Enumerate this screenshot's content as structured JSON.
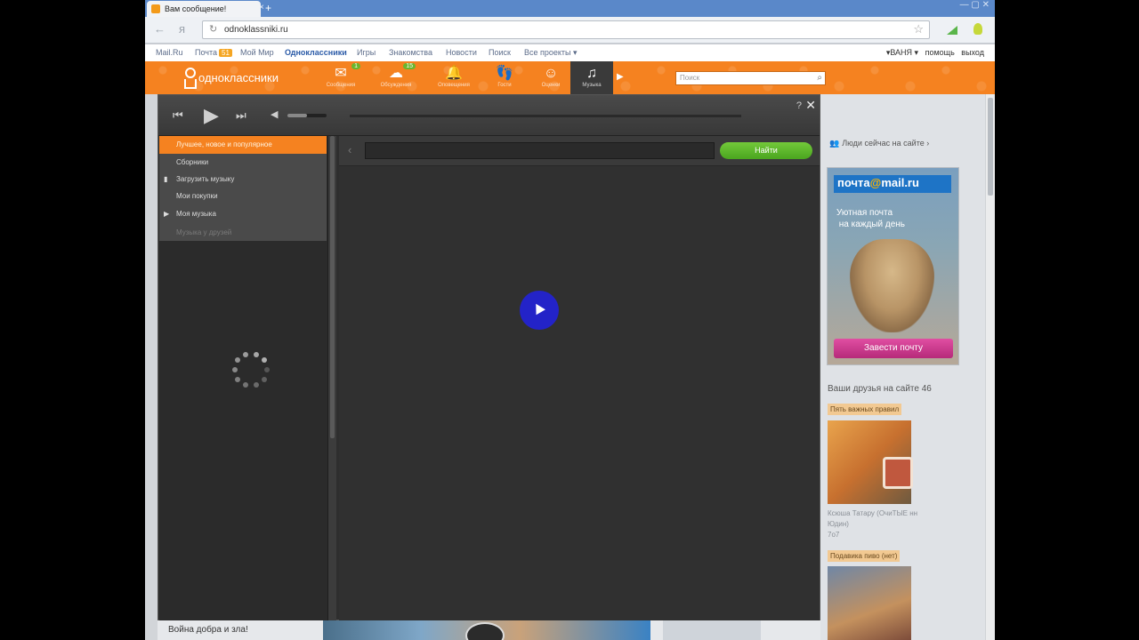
{
  "browser": {
    "tab_title": "Вам сообщение!",
    "tab_close": "×",
    "new_tab": "+",
    "win_controls": "— ▢ ✕",
    "url": "odnoklassniki.ru"
  },
  "mailbar": {
    "links": [
      "Mail.Ru",
      "Почта",
      "Мой Мир",
      "Одноклассники",
      "Игры",
      "Знакомства",
      "Новости",
      "Поиск",
      "Все проекты ▾"
    ],
    "mail_count": "51",
    "user": "▾ВАНЯ ▾",
    "help": "помощь",
    "exit": "выход"
  },
  "okbar": {
    "logo_text": "одноклассники",
    "icons": [
      {
        "name": "messages",
        "label": "Сообщения",
        "glyph": "✉",
        "badge": "1"
      },
      {
        "name": "discussions",
        "label": "Обсуждения",
        "glyph": "☁",
        "badge": "15"
      },
      {
        "name": "notifications",
        "label": "Оповещения",
        "glyph": "🔔",
        "badge": ""
      },
      {
        "name": "guests",
        "label": "Гости",
        "glyph": "👣",
        "badge": ""
      },
      {
        "name": "ratings",
        "label": "Оценки",
        "glyph": "☺",
        "badge": ""
      },
      {
        "name": "music",
        "label": "Музыка",
        "glyph": "♫",
        "badge": ""
      }
    ],
    "more": "▶",
    "search_placeholder": "Поиск"
  },
  "player": {
    "help": "?",
    "close": "✕",
    "volume_level": 0.5,
    "menu": [
      {
        "label": "Лучшее, новое и популярное",
        "state": "active",
        "icon": ""
      },
      {
        "label": "Сборники",
        "state": "normal",
        "icon": ""
      },
      {
        "label": "Загрузить музыку",
        "state": "normal",
        "icon": "▮"
      },
      {
        "label": "Мои покупки",
        "state": "normal",
        "icon": ""
      },
      {
        "label": "Моя музыка",
        "state": "normal",
        "icon": "▶"
      },
      {
        "label": "Музыка у друзей",
        "state": "disabled",
        "icon": ""
      }
    ],
    "search_value": "",
    "find_label": "Найти"
  },
  "right_col": {
    "people_online": "Люди сейчас на сайте ›",
    "ad": {
      "logo_prefix": "почта",
      "logo_at": "@",
      "logo_suffix": "mail.ru",
      "tagline": "Уютная почта\n на каждый день",
      "button": "Завести почту"
    },
    "friends_title": "Ваши друзья на сайте 46",
    "friend_tags": [
      "Пять важных правил",
      "Подавика пиво (нет)"
    ],
    "friend1_name": "Ксюша Татару (ОчиТЫЕ нн\nЮдин)\n7о7"
  },
  "bottom": {
    "title": "Война добра и зла!"
  }
}
